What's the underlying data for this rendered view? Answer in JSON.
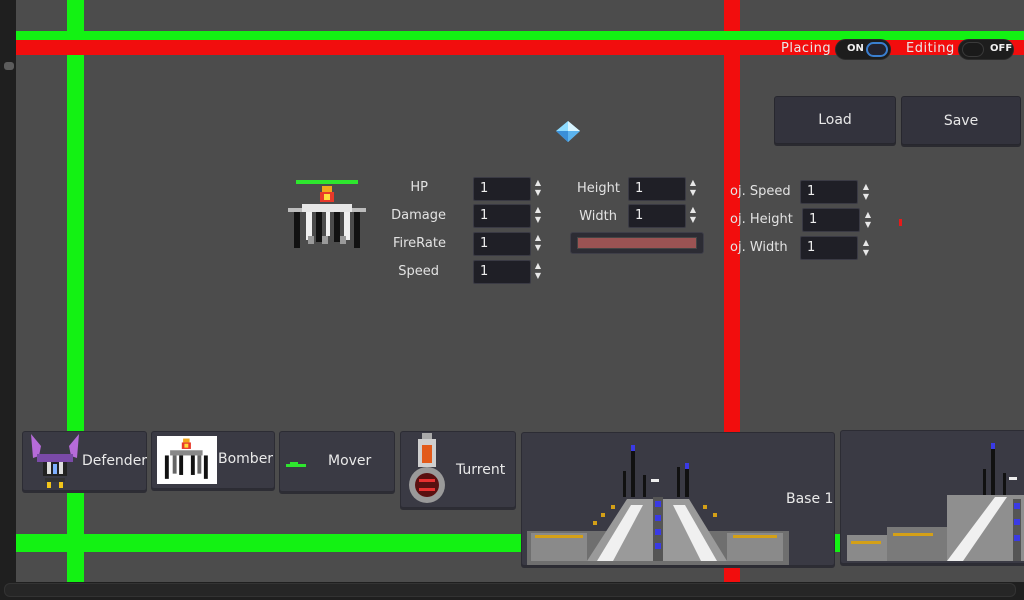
{
  "toolbar": {
    "placing_label": "Placing",
    "placing_state": "ON",
    "editing_label": "Editing",
    "editing_state": "OFF",
    "load_label": "Load",
    "save_label": "Save"
  },
  "unit_stats": [
    {
      "label": "HP",
      "value": "1"
    },
    {
      "label": "Damage",
      "value": "1"
    },
    {
      "label": "FireRate",
      "value": "1"
    },
    {
      "label": "Speed",
      "value": "1"
    }
  ],
  "dimensions": [
    {
      "label": "Height",
      "value": "1"
    },
    {
      "label": "Width",
      "value": "1"
    }
  ],
  "projectile": [
    {
      "label": "oj. Speed",
      "value": "1"
    },
    {
      "label": "oj. Height",
      "value": "1"
    },
    {
      "label": "oj. Width",
      "value": "1"
    }
  ],
  "color_swatch": "#9b5353",
  "palette": [
    {
      "label": "Defender"
    },
    {
      "label": "Bomber"
    },
    {
      "label": "Mover"
    },
    {
      "label": "Turrent"
    },
    {
      "label": "Base 1"
    }
  ],
  "colors": {
    "guide_green": "#13f213",
    "guide_red": "#f20d0d",
    "background": "#4c4c4c"
  }
}
